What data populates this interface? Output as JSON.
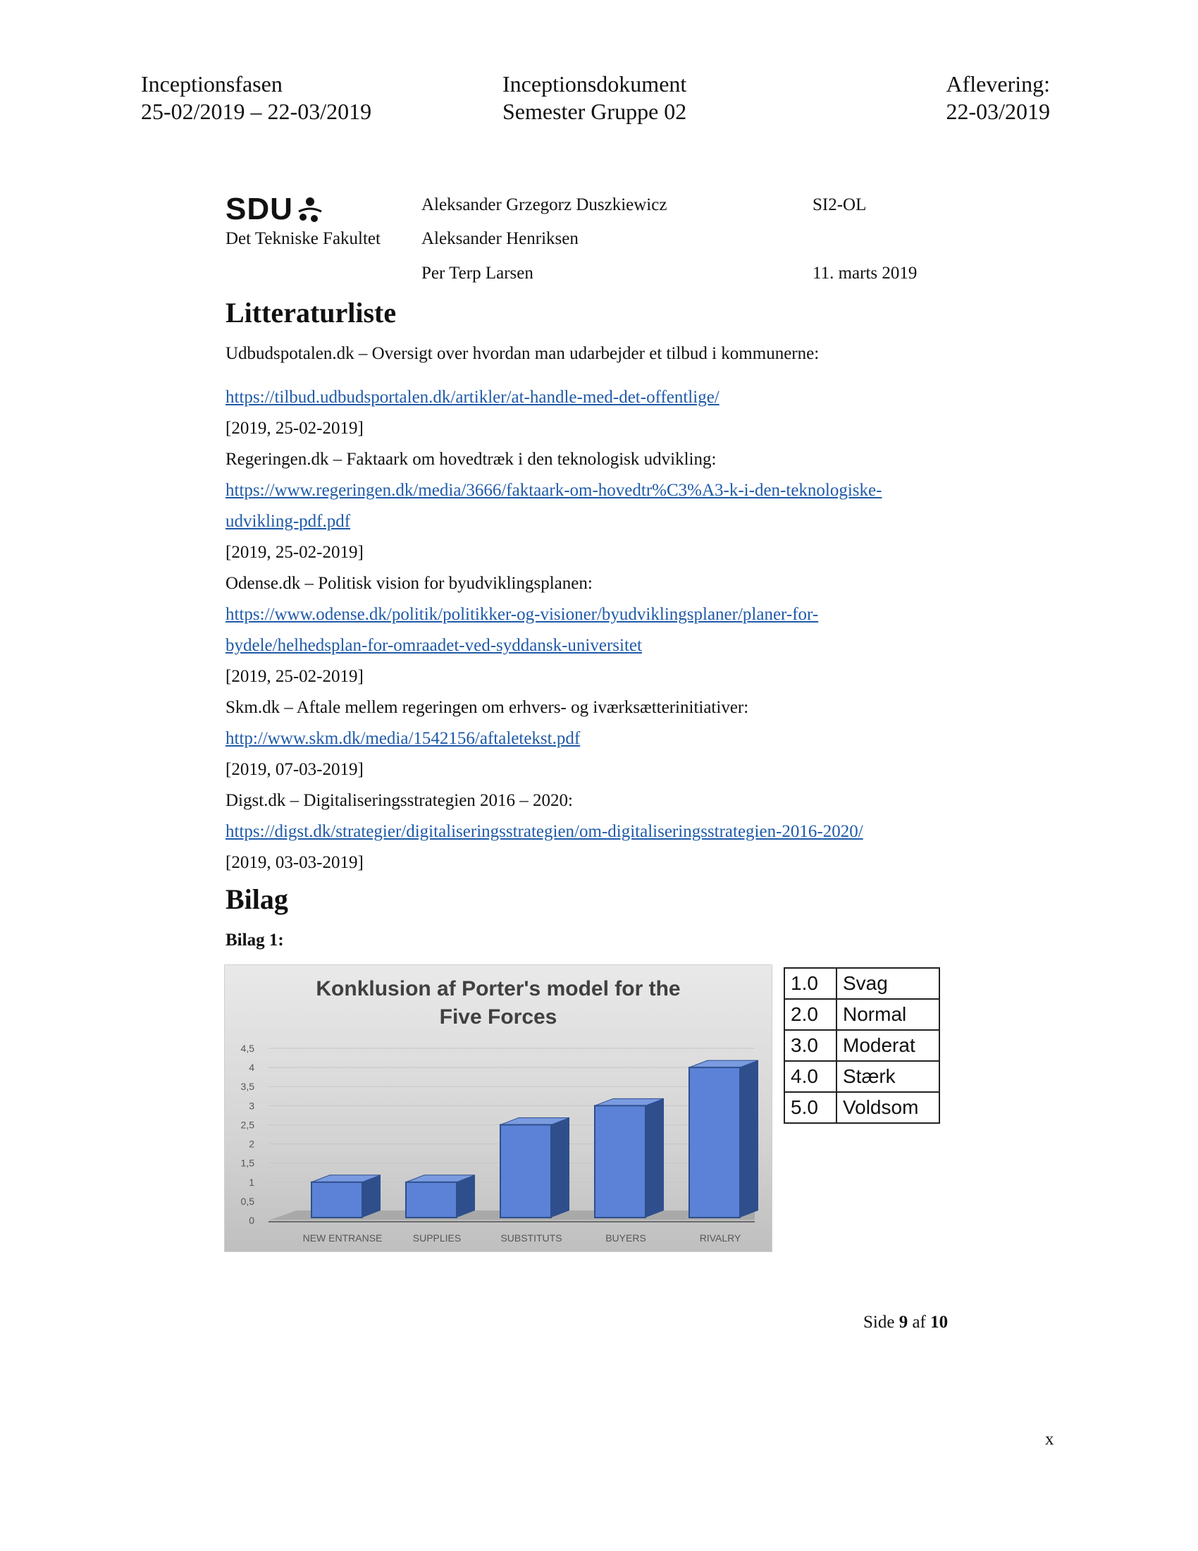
{
  "header": {
    "left": [
      "Inceptionsfasen",
      "25-02/2019 – 22-03/2019"
    ],
    "center": [
      "Inceptionsdokument",
      "Semester Gruppe 02"
    ],
    "right": [
      "Aflevering:",
      "22-03/2019"
    ]
  },
  "meta": {
    "logo_text": "SDU",
    "faculty": "Det Tekniske Fakultet",
    "authors": [
      "Aleksander Grzegorz Duszkiewicz",
      "Aleksander Henriksen",
      "Per Terp Larsen"
    ],
    "course": "SI2-OL",
    "date": "11. marts 2019"
  },
  "literature": {
    "heading": "Litteraturliste",
    "entries": [
      {
        "desc": "Udbudspotalen.dk – Oversigt over hvordan man udarbejder et tilbud i kommunerne:",
        "url_lines": [
          "https://tilbud.udbudsportalen.dk/artikler/at-handle-med-det-offentlige/"
        ],
        "date": "[2019, 25-02-2019]"
      },
      {
        "desc": "Regeringen.dk – Faktaark om hovedtræk i den teknologisk udvikling:",
        "url_lines": [
          "https://www.regeringen.dk/media/3666/faktaark-om-hovedtr%C3%A3-k-i-den-teknologiske-",
          "udvikling-pdf.pdf"
        ],
        "date": "[2019, 25-02-2019]"
      },
      {
        "desc": "Odense.dk – Politisk vision for byudviklingsplanen:",
        "url_lines": [
          "https://www.odense.dk/politik/politikker-og-visioner/byudviklingsplaner/planer-for-",
          "bydele/helhedsplan-for-omraadet-ved-syddansk-universitet"
        ],
        "date": "[2019, 25-02-2019]"
      },
      {
        "desc": "Skm.dk – Aftale mellem regeringen om erhvers- og iværksætterinitiativer:",
        "url_lines": [
          "http://www.skm.dk/media/1542156/aftaletekst.pdf"
        ],
        "date": "[2019, 07-03-2019]"
      },
      {
        "desc": "Digst.dk – Digitaliseringsstrategien 2016 – 2020:",
        "url_lines": [
          "https://digst.dk/strategier/digitaliseringsstrategien/om-digitaliseringsstrategien-2016-2020/"
        ],
        "date": "[2019, 03-03-2019]"
      }
    ]
  },
  "appendix": {
    "heading": "Bilag",
    "label": "Bilag 1:"
  },
  "chart_data": {
    "type": "bar",
    "title_lines": [
      "Konklusion af Porter's model for the",
      "Five Forces"
    ],
    "categories": [
      "NEW ENTRANSE",
      "SUPPLIES",
      "SUBSTITUTS",
      "BUYERS",
      "RIVALRY"
    ],
    "values": [
      1.0,
      1.0,
      2.5,
      3.0,
      4.0
    ],
    "yticks": [
      "0",
      "0,5",
      "1",
      "1,5",
      "2",
      "2,5",
      "3",
      "3,5",
      "4",
      "4,5"
    ],
    "ylim": [
      0,
      4.5
    ],
    "grid": true,
    "bar_color": "#5b82d6",
    "bar_dark": "#2e4f8c"
  },
  "scale_table": [
    {
      "value": "1.0",
      "label": "Svag"
    },
    {
      "value": "2.0",
      "label": "Normal"
    },
    {
      "value": "3.0",
      "label": "Moderat"
    },
    {
      "value": "4.0",
      "label": "Stærk"
    },
    {
      "value": "5.0",
      "label": "Voldsom"
    }
  ],
  "footer": {
    "side_word": "Side",
    "page": "9",
    "of_word": "af",
    "total": "10",
    "mark": "x"
  }
}
